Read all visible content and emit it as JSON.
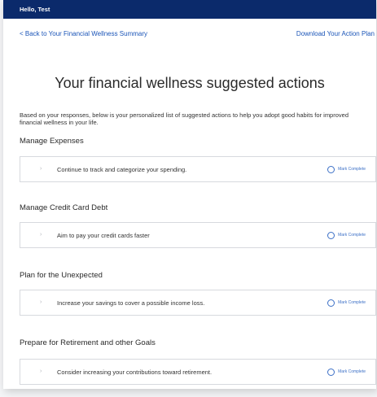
{
  "header": {
    "greeting": "Hello, Test"
  },
  "nav": {
    "back_link": "< Back to Your Financial Wellness Summary",
    "download_link": "Download Your Action Plan"
  },
  "page": {
    "title": "Your financial wellness suggested actions",
    "intro": "Based on your responses, below is your personalized list of suggested actions to help you adopt good habits for improved financial wellness in your life."
  },
  "sections": [
    {
      "title": "Manage Expenses",
      "action": "Continue to track and categorize your spending.",
      "mark_label": "Mark Complete",
      "chevron": "›"
    },
    {
      "title": "Manage Credit Card Debt",
      "action": "Aim to pay your credit cards faster",
      "mark_label": "Mark Complete",
      "chevron": "›"
    },
    {
      "title": "Plan for the Unexpected",
      "action": "Increase your savings to cover a possible income loss.",
      "mark_label": "Mark Complete",
      "chevron": "›"
    },
    {
      "title": "Prepare for Retirement and other Goals",
      "action": "Consider increasing your contributions toward retirement.",
      "mark_label": "Mark Complete",
      "chevron": "›"
    }
  ],
  "colors": {
    "topbar": "#0b2a6b",
    "link": "#1b55b8",
    "mark": "#3b6fc6"
  }
}
